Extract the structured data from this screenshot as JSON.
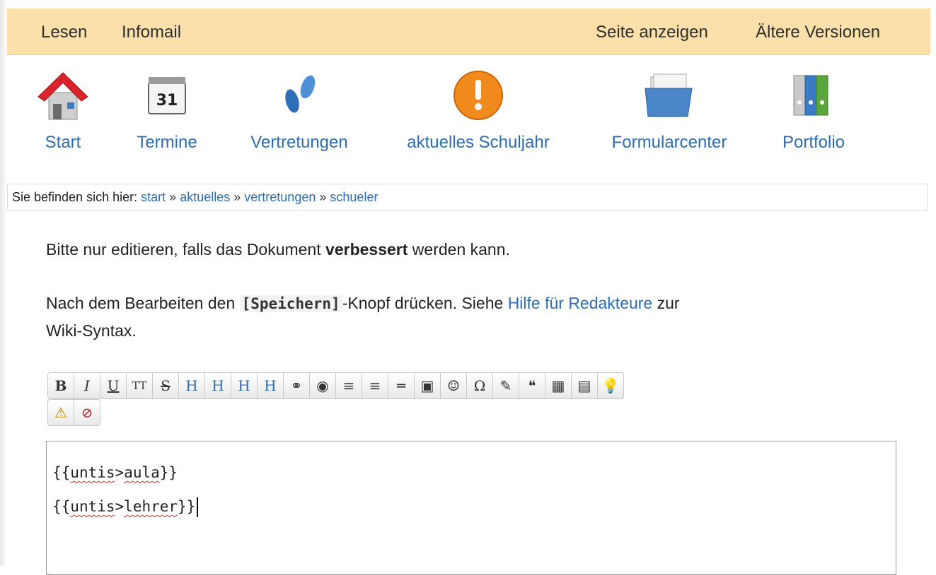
{
  "topbar": {
    "left_links": [
      "Lesen",
      "Infomail"
    ],
    "right_links": [
      "Seite anzeigen",
      "Ältere Versionen"
    ]
  },
  "nav": [
    {
      "label": "Start",
      "icon": "home-icon"
    },
    {
      "label": "Termine",
      "icon": "calendar-icon",
      "icon_text": "31"
    },
    {
      "label": "Vertretungen",
      "icon": "footprints-icon"
    },
    {
      "label": "aktuelles Schuljahr",
      "icon": "exclamation-icon"
    },
    {
      "label": "Formularcenter",
      "icon": "folder-icon"
    },
    {
      "label": "Portfolio",
      "icon": "binders-icon"
    }
  ],
  "breadcrumb": {
    "prefix": "Sie befinden sich hier:",
    "items": [
      "start",
      "aktuelles",
      "vertretungen",
      "schueler"
    ],
    "separator": "»"
  },
  "intro": {
    "line1_before": "Bitte nur editieren, falls das Dokument",
    "line1_bold": "verbessert",
    "line1_after": "werden kann.",
    "line2_before": "Nach dem Bearbeiten den",
    "line2_code": "[Speichern]",
    "line2_mid": "-Knopf drücken. Siehe",
    "line2_link": "Hilfe für Redakteure",
    "line2_after": "zur",
    "line3": "Wiki-Syntax."
  },
  "toolbar": {
    "buttons": [
      {
        "name": "bold-button",
        "glyph": "B"
      },
      {
        "name": "italic-button",
        "glyph": "I"
      },
      {
        "name": "underline-button",
        "glyph": "U"
      },
      {
        "name": "monospace-button",
        "glyph": "TT"
      },
      {
        "name": "strikethrough-button",
        "glyph": "S"
      },
      {
        "name": "heading-same-button",
        "glyph": "H"
      },
      {
        "name": "heading-lower-button",
        "glyph": "H"
      },
      {
        "name": "heading-higher-button",
        "glyph": "H"
      },
      {
        "name": "heading-select-button",
        "glyph": "H"
      },
      {
        "name": "link-button",
        "glyph": "⚭"
      },
      {
        "name": "external-link-button",
        "glyph": "◉"
      },
      {
        "name": "ordered-list-button",
        "glyph": "≡"
      },
      {
        "name": "unordered-list-button",
        "glyph": "≡"
      },
      {
        "name": "horizontal-rule-button",
        "glyph": "═"
      },
      {
        "name": "media-button",
        "glyph": "▣"
      },
      {
        "name": "smiley-button",
        "glyph": "☺"
      },
      {
        "name": "special-chars-button",
        "glyph": "Ω"
      },
      {
        "name": "signature-button",
        "glyph": "✎"
      },
      {
        "name": "quote-button",
        "glyph": "❝"
      },
      {
        "name": "table-button",
        "glyph": "▦"
      },
      {
        "name": "note-button",
        "glyph": "▤"
      },
      {
        "name": "tip-button",
        "glyph": "💡"
      }
    ],
    "row2": [
      {
        "name": "warning-button",
        "glyph": "⚠"
      },
      {
        "name": "stop-button",
        "glyph": "⊘"
      }
    ]
  },
  "editor": {
    "lines": [
      {
        "pre": "{{",
        "w1": "untis",
        "gt": ">",
        "w2": "aula",
        "post": "}}"
      },
      {
        "pre": "{{",
        "w1": "untis",
        "gt": ">",
        "w2": "lehrer",
        "post": "}}"
      }
    ]
  },
  "colors": {
    "topbar": "#fbe0a9",
    "link": "#2b6cb3",
    "home_roof": "#d8242a",
    "warning_orange": "#f08a1c"
  }
}
